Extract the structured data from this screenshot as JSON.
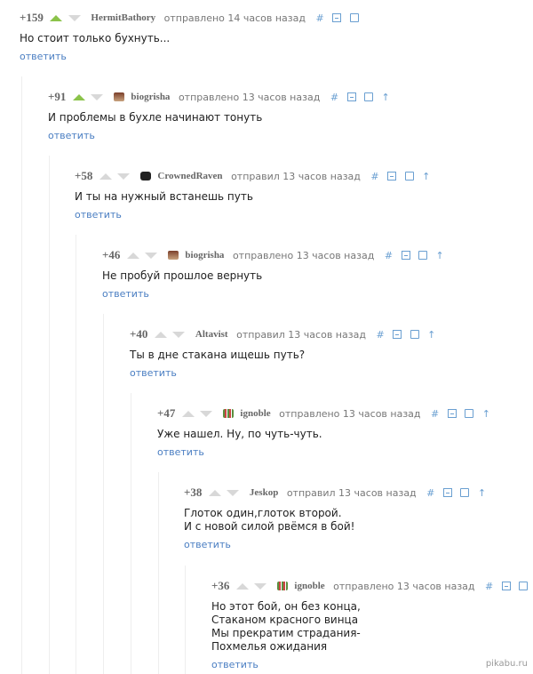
{
  "comments": [
    {
      "rating": "+159",
      "author": "HermitBathory",
      "posted": "отправлено 14 часов назад",
      "hash": "#",
      "lines": [
        "Но стоит только бухнуть..."
      ],
      "reply": "ответить"
    },
    {
      "rating": "+91",
      "author": "biogrisha",
      "posted": "отправлено 13 часов назад",
      "hash": "#",
      "up_icon": "↑",
      "lines": [
        "И проблемы в бухле начинают тонуть"
      ],
      "reply": "ответить"
    },
    {
      "rating": "+58",
      "author": "CrownedRaven",
      "posted": "отправил 13 часов назад",
      "hash": "#",
      "up_icon": "↑",
      "lines": [
        "И ты на нужный встанешь путь"
      ],
      "reply": "ответить"
    },
    {
      "rating": "+46",
      "author": "biogrisha",
      "posted": "отправлено 13 часов назад",
      "hash": "#",
      "up_icon": "↑",
      "lines": [
        "Не пробуй прошлое вернуть"
      ],
      "reply": "ответить"
    },
    {
      "rating": "+40",
      "author": "Altavist",
      "posted": "отправил 13 часов назад",
      "hash": "#",
      "up_icon": "↑",
      "lines": [
        "Ты в дне стакана ищешь путь?"
      ],
      "reply": "ответить"
    },
    {
      "rating": "+47",
      "author": "ignoble",
      "posted": "отправлено 13 часов назад",
      "hash": "#",
      "up_icon": "↑",
      "lines": [
        "Уже нашел. Ну, по чуть-чуть."
      ],
      "reply": "ответить"
    },
    {
      "rating": "+38",
      "author": "Jeskop",
      "posted": "отправил 13 часов назад",
      "hash": "#",
      "up_icon": "↑",
      "lines": [
        "Глоток один,глоток второй.",
        "И с новой силой рвёмся в бой!"
      ],
      "reply": "ответить"
    },
    {
      "rating": "+36",
      "author": "ignoble",
      "posted": "отправлено 13 часов назад",
      "hash": "#",
      "up_icon": "↑",
      "lines": [
        "Но этот бой, он без конца,",
        "Стаканом красного винца",
        "Мы прекратим страдания-",
        "Похмелья ожидания"
      ],
      "reply": "ответить"
    }
  ],
  "watermark": "pikabu.ru"
}
